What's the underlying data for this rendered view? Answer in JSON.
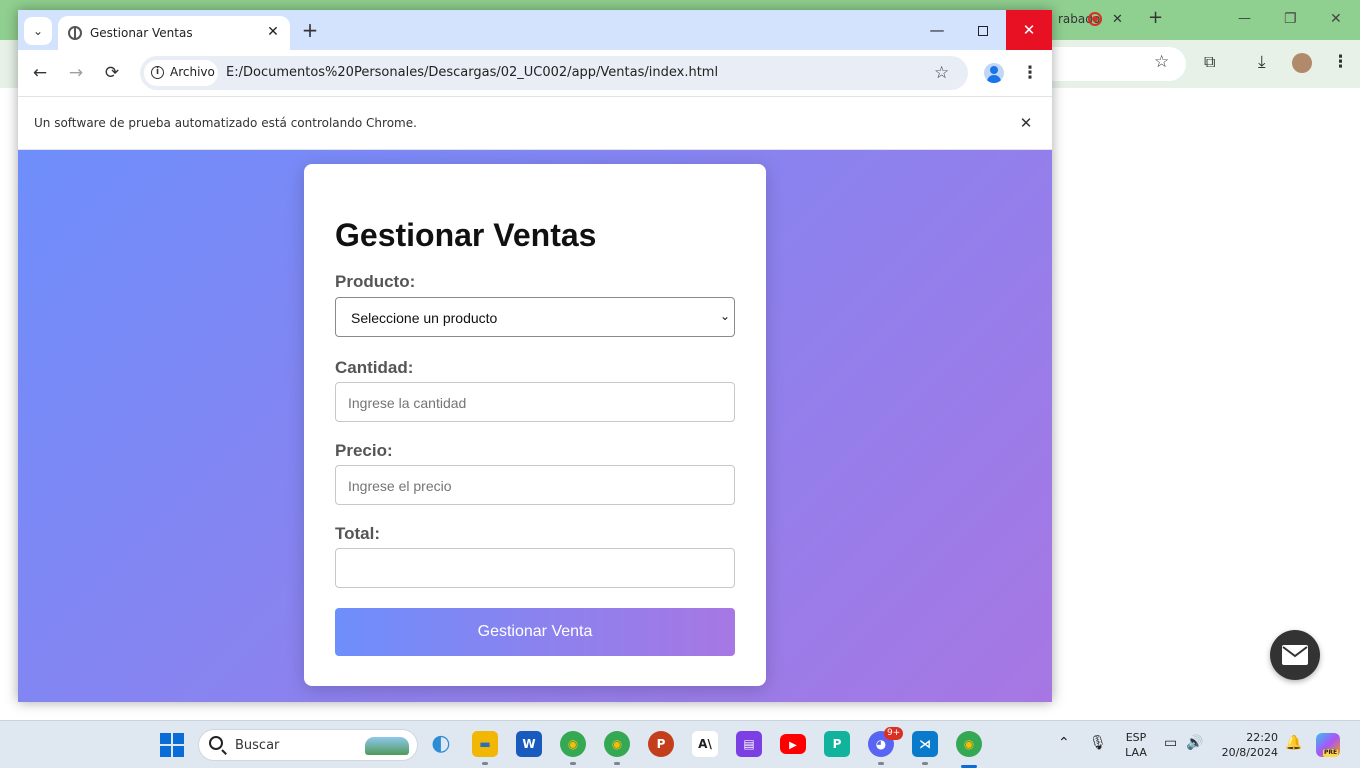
{
  "background_window": {
    "tab_label": "rabado",
    "new_tab_glyph": "+",
    "close_glyph": "✕",
    "minimize_glyph": "—",
    "restore_glyph": "❐",
    "window_close_glyph": "✕",
    "bookmark_glyph": "☆",
    "extensions_glyph": "⧉",
    "download_glyph": "⤓",
    "menu_glyph": "⋮"
  },
  "browser": {
    "tab_search_glyph": "⌄",
    "tab": {
      "title": "Gestionar Ventas",
      "close_glyph": "✕"
    },
    "new_tab_glyph": "+",
    "window_controls": {
      "minimize_glyph": "—",
      "close_glyph": "✕"
    },
    "nav": {
      "back_glyph": "←",
      "forward_glyph": "→",
      "reload_glyph": "⟳"
    },
    "address": {
      "chip_icon": "i",
      "chip_label": "Archivo",
      "url": "E:/Documentos%20Personales/Descargas/02_UC002/app/Ventas/index.html"
    },
    "bookmark_glyph": "☆",
    "menu_glyph": "⋮",
    "infobar": {
      "message": "Un software de prueba automatizado está controlando Chrome.",
      "close_glyph": "✕"
    }
  },
  "page": {
    "title": "Gestionar Ventas",
    "form": {
      "producto_label": "Producto:",
      "producto_selected": "Seleccione un producto",
      "producto_arrow": "⌄",
      "cantidad_label": "Cantidad:",
      "cantidad_placeholder": "Ingrese la cantidad",
      "precio_label": "Precio:",
      "precio_placeholder": "Ingrese el precio",
      "total_label": "Total:",
      "total_value": "",
      "submit_label": "Gestionar Venta"
    },
    "colors": {
      "gradient_start": "#6e8efb",
      "gradient_end": "#a777e3"
    }
  },
  "taskbar": {
    "search_label": "Buscar",
    "apps": [
      {
        "name": "widgets",
        "glyph": "◐",
        "color": "#2d8cd6"
      },
      {
        "name": "file-explorer",
        "glyph": "▬",
        "color": "#f2b705"
      },
      {
        "name": "word",
        "glyph": "W",
        "color": "#185abd"
      },
      {
        "name": "chrome-profile-1",
        "glyph": "◉",
        "color": "#34a853"
      },
      {
        "name": "chrome-profile-2",
        "glyph": "◉",
        "color": "#34a853"
      },
      {
        "name": "powerpoint",
        "glyph": "P",
        "color": "#c43e1c"
      },
      {
        "name": "app-a",
        "glyph": "A\\",
        "color": "#1f1f1f"
      },
      {
        "name": "clapper",
        "glyph": "▤",
        "color": "#7b3fe4"
      },
      {
        "name": "youtube",
        "glyph": "▶",
        "color": "#ff0000"
      },
      {
        "name": "pycharm",
        "glyph": "P",
        "color": "#11b39d"
      },
      {
        "name": "discord",
        "glyph": "◕",
        "color": "#5865f2"
      },
      {
        "name": "vscode",
        "glyph": "⋊",
        "color": "#0a7acc"
      },
      {
        "name": "chrome-active",
        "glyph": "◉",
        "color": "#34a853"
      }
    ],
    "discord_badge": "9+",
    "tray": {
      "chevron_glyph": "⌃",
      "mic_glyph": "🎙",
      "lang_line1": "ESP",
      "lang_line2": "LAA",
      "network_glyph": "▭",
      "volume_glyph": "🔊",
      "time": "22:20",
      "date": "20/8/2024",
      "bell_glyph": "🔔",
      "copilot_tag": "PRE"
    }
  }
}
